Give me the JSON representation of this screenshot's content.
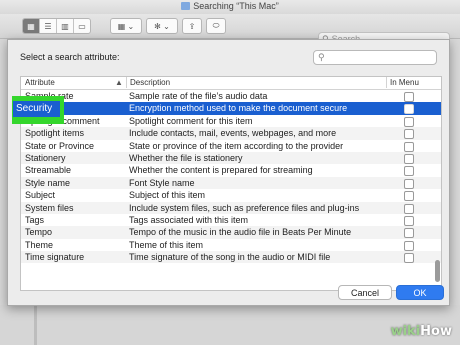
{
  "window": {
    "title": "Searching “This Mac”",
    "search_placeholder": "Search"
  },
  "toolbar": {
    "view_icons": [
      "grid-view-icon",
      "list-view-icon",
      "column-view-icon",
      "gallery-view-icon"
    ],
    "group_icon": "group-icon",
    "action_icon": "gear-icon",
    "share_icon": "share-icon",
    "tag_icon": "tag-icon"
  },
  "dialog": {
    "prompt": "Select a search attribute:",
    "columns": {
      "attribute": "Attribute",
      "description": "Description",
      "in_menu": "In Menu"
    },
    "rows": [
      {
        "attribute": "Sample rate",
        "description": "Sample rate of the file’s audio data",
        "in_menu": false
      },
      {
        "attribute": "Security",
        "description": "Encryption method used to make the document secure",
        "in_menu": false,
        "selected": true
      },
      {
        "attribute": "Spotlight comment",
        "description": "Spotlight comment for this item",
        "in_menu": false
      },
      {
        "attribute": "Spotlight items",
        "description": "Include contacts, mail, events, webpages, and more",
        "in_menu": false
      },
      {
        "attribute": "State or Province",
        "description": "State or province of the item according to the provider",
        "in_menu": false
      },
      {
        "attribute": "Stationery",
        "description": "Whether the file is stationery",
        "in_menu": false
      },
      {
        "attribute": "Streamable",
        "description": "Whether the content is prepared for streaming",
        "in_menu": false
      },
      {
        "attribute": "Style name",
        "description": "Font Style name",
        "in_menu": false
      },
      {
        "attribute": "Subject",
        "description": "Subject of this item",
        "in_menu": false
      },
      {
        "attribute": "System files",
        "description": "Include system files, such as preference files and plug-ins",
        "in_menu": false
      },
      {
        "attribute": "Tags",
        "description": "Tags associated with this item",
        "in_menu": false
      },
      {
        "attribute": "Tempo",
        "description": "Tempo of the music in the audio file in Beats Per Minute",
        "in_menu": false
      },
      {
        "attribute": "Theme",
        "description": "Theme of this item",
        "in_menu": false
      },
      {
        "attribute": "Time signature",
        "description": "Time signature of the song in the audio or MIDI file",
        "in_menu": false
      }
    ],
    "cancel_label": "Cancel",
    "ok_label": "OK",
    "highlight_label": "Security"
  },
  "watermark": {
    "part1": "wiki",
    "part2": "How"
  },
  "colors": {
    "selection": "#1a5fd0",
    "highlight": "#34d62c",
    "ok_button": "#2f7bf0"
  }
}
